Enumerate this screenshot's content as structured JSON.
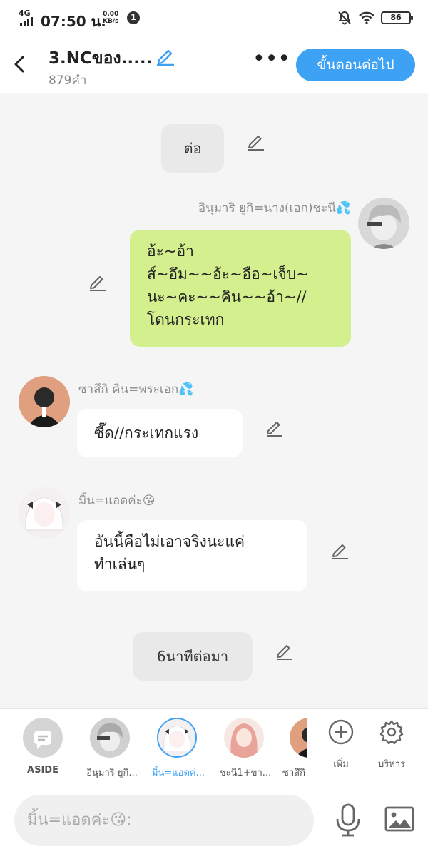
{
  "status_bar": {
    "network": "4G",
    "time": "07:50 น.",
    "speed_value": "0.00",
    "speed_unit": "KB/s",
    "notification_count": "1",
    "battery": "86"
  },
  "header": {
    "title": "3.NCของ.....",
    "word_count": "879คำ",
    "more_label": "•••",
    "next_button": "ขั้นตอนต่อไป"
  },
  "messages": [
    {
      "type": "narration",
      "text": "ต่อ"
    },
    {
      "type": "mine",
      "speaker": "อินุมาริ ยูกิ=นาง(เอก)ชะนี💦",
      "lines": [
        "อ้ะ~อ้า",
        "ส์~อึม~~อ้ะ~อือ~เจ็บ~",
        "นะ~คะ~~คิน~~อ้า~//",
        "โดนกระเทก"
      ]
    },
    {
      "type": "other",
      "speaker": "ซาสึกิ คิน=พระเอก💦",
      "lines": [
        "ซี๊ด//กระเทกแรง"
      ]
    },
    {
      "type": "other",
      "speaker": "มิ้น=แอดค่ะ😘",
      "lines": [
        "อันนี้คือไม่เอาจริงนะแค่",
        "ทำเล่นๆ"
      ]
    },
    {
      "type": "narration",
      "text": "6นาทีต่อมา"
    }
  ],
  "character_bar": {
    "items": [
      {
        "label": "ASIDE"
      },
      {
        "label": "อินุมาริ ยูกิ..."
      },
      {
        "label": "มิ้น=แอดค่...",
        "selected": true
      },
      {
        "label": "ชะนี1+ขา..."
      },
      {
        "label": "ซาสึกิ"
      }
    ],
    "add_label": "เพิ่ม",
    "manage_label": "บริหาร"
  },
  "input_bar": {
    "placeholder": "มิ้น=แอดค่ะ😘:"
  },
  "colors": {
    "accent": "#3ea2f4",
    "my_bubble": "#d3ef8e",
    "background": "#f5f5f5"
  }
}
